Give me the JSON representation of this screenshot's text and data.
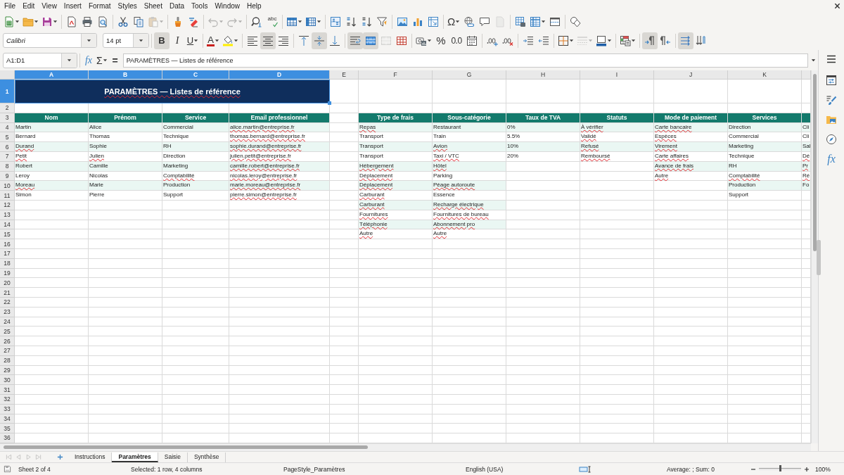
{
  "menu_bar": {
    "items": [
      "File",
      "Edit",
      "View",
      "Insert",
      "Format",
      "Styles",
      "Sheet",
      "Data",
      "Tools",
      "Window",
      "Help"
    ]
  },
  "standard_toolbar": [
    [
      {
        "kind": "new",
        "disabled": false
      },
      {
        "kind": "open",
        "disabled": false
      },
      {
        "kind": "save",
        "disabled": false
      }
    ],
    [
      {
        "kind": "pdf",
        "disabled": false
      },
      {
        "kind": "print",
        "disabled": false
      },
      {
        "kind": "preview",
        "disabled": false
      }
    ],
    [
      {
        "kind": "cut",
        "disabled": false
      },
      {
        "kind": "copy",
        "disabled": false
      },
      {
        "kind": "paste",
        "disabled": true
      }
    ],
    [
      {
        "kind": "clone",
        "disabled": false
      },
      {
        "kind": "clear",
        "disabled": false
      }
    ],
    [
      {
        "kind": "undo",
        "disabled": true
      },
      {
        "kind": "redo",
        "disabled": true
      }
    ],
    [
      {
        "kind": "find",
        "disabled": false
      },
      {
        "kind": "spelling",
        "label": "abc",
        "disabled": false
      }
    ],
    [
      {
        "kind": "row",
        "disabled": false
      },
      {
        "kind": "column",
        "disabled": false
      }
    ],
    [
      {
        "kind": "sort",
        "disabled": false
      },
      {
        "kind": "ascending",
        "disabled": false
      },
      {
        "kind": "descending",
        "disabled": false
      },
      {
        "kind": "filter",
        "disabled": false
      }
    ],
    [
      {
        "kind": "image",
        "disabled": false
      },
      {
        "kind": "chart",
        "disabled": false
      },
      {
        "kind": "pivot",
        "disabled": false
      }
    ],
    [
      {
        "kind": "special",
        "label": "Ω",
        "disabled": false
      },
      {
        "kind": "hyperlink",
        "disabled": false
      },
      {
        "kind": "comment",
        "disabled": false
      },
      {
        "kind": "headers",
        "disabled": true
      }
    ],
    [
      {
        "kind": "printarea",
        "disabled": false
      },
      {
        "kind": "freeze",
        "disabled": false
      },
      {
        "kind": "split",
        "disabled": false
      }
    ],
    [
      {
        "kind": "shapes",
        "disabled": false
      }
    ]
  ],
  "formatting_toolbar": {
    "font_name": "Calibri",
    "font_size": "14 pt",
    "groups": [
      [
        {
          "kind": "bold",
          "label": "B",
          "on": true,
          "disabled": false
        },
        {
          "kind": "italic",
          "label": "I",
          "on": false,
          "disabled": false
        },
        {
          "kind": "underline",
          "label": "U",
          "on": false,
          "disabled": false
        }
      ],
      [
        {
          "kind": "fontcolor",
          "label": "A",
          "on": false,
          "disabled": false
        },
        {
          "kind": "highlight",
          "on": false,
          "disabled": false
        }
      ],
      [
        {
          "kind": "alignleft",
          "on": false,
          "disabled": false
        },
        {
          "kind": "aligncenter",
          "on": true,
          "disabled": false
        },
        {
          "kind": "alignright",
          "on": false,
          "disabled": false
        }
      ],
      [
        {
          "kind": "aligntop",
          "on": false,
          "disabled": false
        },
        {
          "kind": "alignmiddle",
          "on": true,
          "disabled": false
        },
        {
          "kind": "alignbottom",
          "on": false,
          "disabled": false
        }
      ],
      [
        {
          "kind": "wrap",
          "on": true,
          "disabled": false
        },
        {
          "kind": "mergecenter",
          "on": true,
          "disabled": false
        },
        {
          "kind": "merge",
          "on": false,
          "disabled": true
        },
        {
          "kind": "unmerge",
          "on": false,
          "disabled": false
        }
      ],
      [
        {
          "kind": "currency",
          "on": false,
          "disabled": false
        },
        {
          "kind": "percent",
          "label": "%",
          "on": false,
          "disabled": false
        },
        {
          "kind": "number",
          "label": "0.0",
          "on": false,
          "disabled": false
        },
        {
          "kind": "date",
          "on": false,
          "disabled": false
        }
      ],
      [
        {
          "kind": "adddecimal",
          "on": false,
          "disabled": false
        },
        {
          "kind": "deldecimal",
          "on": false,
          "disabled": false
        }
      ],
      [
        {
          "kind": "indent",
          "on": false,
          "disabled": false
        },
        {
          "kind": "outdent",
          "on": false,
          "disabled": false
        }
      ],
      [
        {
          "kind": "borders",
          "on": false,
          "disabled": false
        },
        {
          "kind": "borderstyle",
          "on": false,
          "disabled": true
        },
        {
          "kind": "bordercolor",
          "on": false,
          "disabled": false
        }
      ],
      [
        {
          "kind": "conditional",
          "on": false,
          "disabled": false
        }
      ],
      [
        {
          "kind": "ltr",
          "on": true,
          "disabled": false
        },
        {
          "kind": "rtl",
          "on": false,
          "disabled": false
        }
      ],
      [
        {
          "kind": "horizontal",
          "on": true,
          "disabled": false
        },
        {
          "kind": "vertical",
          "on": false,
          "disabled": false
        }
      ]
    ]
  },
  "formula_bar": {
    "name_box": "A1:D1",
    "buttons": [
      {
        "kind": "wizard",
        "label": "fx"
      },
      {
        "kind": "sum",
        "label": "Σ"
      },
      {
        "kind": "formula",
        "label": "="
      }
    ],
    "content": "PARAMÈTRES — Listes de référence"
  },
  "sidebar": {
    "buttons": [
      {
        "kind": "menu"
      },
      {
        "kind": "properties"
      },
      {
        "kind": "styles"
      },
      {
        "kind": "gallery"
      },
      {
        "kind": "navigator"
      },
      {
        "kind": "functions",
        "label": "fx"
      }
    ]
  },
  "sheet": {
    "columns": [
      {
        "label": "A",
        "selected": true
      },
      {
        "label": "B",
        "selected": true
      },
      {
        "label": "C",
        "selected": true
      },
      {
        "label": "D",
        "selected": true
      },
      {
        "label": "E",
        "selected": false
      },
      {
        "label": "F",
        "selected": false
      },
      {
        "label": "G",
        "selected": false
      },
      {
        "label": "H",
        "selected": false
      },
      {
        "label": "I",
        "selected": false
      },
      {
        "label": "J",
        "selected": false
      },
      {
        "label": "K",
        "selected": false
      }
    ],
    "rows": [
      {
        "label": "1",
        "selected": true
      },
      {
        "label": "2",
        "selected": false
      },
      {
        "label": "3",
        "selected": false
      },
      {
        "label": "4",
        "selected": false
      },
      {
        "label": "5",
        "selected": false
      },
      {
        "label": "6",
        "selected": false
      },
      {
        "label": "7",
        "selected": false
      },
      {
        "label": "8",
        "selected": false
      },
      {
        "label": "9",
        "selected": false
      },
      {
        "label": "10",
        "selected": false
      },
      {
        "label": "11",
        "selected": false
      },
      {
        "label": "12",
        "selected": false
      },
      {
        "label": "13",
        "selected": false
      },
      {
        "label": "14",
        "selected": false
      },
      {
        "label": "15",
        "selected": false
      },
      {
        "label": "16",
        "selected": false
      },
      {
        "label": "17",
        "selected": false
      },
      {
        "label": "18",
        "selected": false
      },
      {
        "label": "19",
        "selected": false
      },
      {
        "label": "20",
        "selected": false
      },
      {
        "label": "21",
        "selected": false
      },
      {
        "label": "22",
        "selected": false
      },
      {
        "label": "23",
        "selected": false
      },
      {
        "label": "24",
        "selected": false
      },
      {
        "label": "25",
        "selected": false
      },
      {
        "label": "26",
        "selected": false
      },
      {
        "label": "27",
        "selected": false
      },
      {
        "label": "28",
        "selected": false
      },
      {
        "label": "29",
        "selected": false
      },
      {
        "label": "30",
        "selected": false
      },
      {
        "label": "31",
        "selected": false
      },
      {
        "label": "32",
        "selected": false
      },
      {
        "label": "33",
        "selected": false
      },
      {
        "label": "34",
        "selected": false
      },
      {
        "label": "35",
        "selected": false
      },
      {
        "label": "36",
        "selected": false
      }
    ],
    "title": {
      "text": "PARAMÈTRES — Listes de référence",
      "spell_error": true
    },
    "tables": [
      {
        "columns": [
          {
            "header": "Nom",
            "cells": [
              {
                "text": "Martin",
                "spell_error": false
              },
              {
                "text": "Bernard",
                "spell_error": false
              },
              {
                "text": "Durand",
                "spell_error": true
              },
              {
                "text": "Petit",
                "spell_error": true
              },
              {
                "text": "Robert",
                "spell_error": false
              },
              {
                "text": "Leroy",
                "spell_error": false
              },
              {
                "text": "Moreau",
                "spell_error": true
              },
              {
                "text": "Simon",
                "spell_error": false
              }
            ]
          },
          {
            "header": "Prénom",
            "cells": [
              {
                "text": "Alice",
                "spell_error": false
              },
              {
                "text": "Thomas",
                "spell_error": false
              },
              {
                "text": "Sophie",
                "spell_error": false
              },
              {
                "text": "Julien",
                "spell_error": true
              },
              {
                "text": "Camille",
                "spell_error": false
              },
              {
                "text": "Nicolas",
                "spell_error": false
              },
              {
                "text": "Marie",
                "spell_error": false
              },
              {
                "text": "Pierre",
                "spell_error": false
              }
            ]
          },
          {
            "header": "Service",
            "cells": [
              {
                "text": "Commercial",
                "spell_error": false
              },
              {
                "text": "Technique",
                "spell_error": false
              },
              {
                "text": "RH",
                "spell_error": false
              },
              {
                "text": "Direction",
                "spell_error": false
              },
              {
                "text": "Marketing",
                "spell_error": false
              },
              {
                "text": "Comptabilité",
                "spell_error": true
              },
              {
                "text": "Production",
                "spell_error": false
              },
              {
                "text": "Support",
                "spell_error": false
              }
            ]
          },
          {
            "header": "Email professionnel",
            "cells": [
              {
                "text": "alice.martin@entreprise.fr",
                "spell_error": true
              },
              {
                "text": "thomas.bernard@entreprise.fr",
                "spell_error": true
              },
              {
                "text": "sophie.durand@entreprise.fr",
                "spell_error": true
              },
              {
                "text": "julien.petit@entreprise.fr",
                "spell_error": true
              },
              {
                "text": "camille.robert@entreprise.fr",
                "spell_error": true
              },
              {
                "text": "nicolas.leroy@entreprise.fr",
                "spell_error": true
              },
              {
                "text": "marie.moreau@entreprise.fr",
                "spell_error": true
              },
              {
                "text": "pierre.simon@entreprise.fr",
                "spell_error": true
              }
            ]
          }
        ]
      },
      {
        "columns": [
          {
            "header": "Type de frais",
            "cells": [
              {
                "text": "Repas",
                "spell_error": true
              },
              {
                "text": "Transport",
                "spell_error": false
              },
              {
                "text": "Transport",
                "spell_error": false
              },
              {
                "text": "Transport",
                "spell_error": false
              },
              {
                "text": "Hébergement",
                "spell_error": true
              },
              {
                "text": "Déplacement",
                "spell_error": true
              },
              {
                "text": "Déplacement",
                "spell_error": true
              },
              {
                "text": "Carburant",
                "spell_error": true
              },
              {
                "text": "Carburant",
                "spell_error": true
              },
              {
                "text": "Fournitures",
                "spell_error": true
              },
              {
                "text": "Téléphonie",
                "spell_error": true
              },
              {
                "text": "Autre",
                "spell_error": true
              }
            ]
          },
          {
            "header": "Sous-catégorie",
            "cells": [
              {
                "text": "Restaurant",
                "spell_error": false
              },
              {
                "text": "Train",
                "spell_error": false
              },
              {
                "text": "Avion",
                "spell_error": true
              },
              {
                "text": "Taxi / VTC",
                "spell_error": true
              },
              {
                "text": "Hôtel",
                "spell_error": true
              },
              {
                "text": "Parking",
                "spell_error": false
              },
              {
                "text": "Péage autoroute",
                "spell_error": true
              },
              {
                "text": "Essence",
                "spell_error": false
              },
              {
                "text": "Recharge électrique",
                "spell_error": true
              },
              {
                "text": "Fournitures de bureau",
                "spell_error": true
              },
              {
                "text": "Abonnement pro",
                "spell_error": true
              },
              {
                "text": "Autre",
                "spell_error": true
              }
            ]
          }
        ]
      },
      {
        "columns": [
          {
            "header": "Taux de TVA",
            "cells": [
              {
                "text": "0%",
                "spell_error": false
              },
              {
                "text": "5.5%",
                "spell_error": false
              },
              {
                "text": "10%",
                "spell_error": false
              },
              {
                "text": "20%",
                "spell_error": false
              }
            ]
          }
        ]
      },
      {
        "columns": [
          {
            "header": "Statuts",
            "cells": [
              {
                "text": "À vérifier",
                "spell_error": true
              },
              {
                "text": "Validé",
                "spell_error": true
              },
              {
                "text": "Refusé",
                "spell_error": true
              },
              {
                "text": "Remboursé",
                "spell_error": true
              }
            ]
          }
        ]
      },
      {
        "columns": [
          {
            "header": "Mode de paiement",
            "cells": [
              {
                "text": "Carte bancaire",
                "spell_error": true
              },
              {
                "text": "Espèces",
                "spell_error": true
              },
              {
                "text": "Virement",
                "spell_error": true
              },
              {
                "text": "Carte affaires",
                "spell_error": true
              },
              {
                "text": "Avance de frais",
                "spell_error": true
              },
              {
                "text": "Autre",
                "spell_error": true
              }
            ]
          }
        ]
      },
      {
        "columns": [
          {
            "header": "Services",
            "cells": [
              {
                "text": "Direction",
                "spell_error": false
              },
              {
                "text": "Commercial",
                "spell_error": false
              },
              {
                "text": "Marketing",
                "spell_error": false
              },
              {
                "text": "Technique",
                "spell_error": false
              },
              {
                "text": "RH",
                "spell_error": false
              },
              {
                "text": "Comptabilité",
                "spell_error": true
              },
              {
                "text": "Production",
                "spell_error": false
              },
              {
                "text": "Support",
                "spell_error": false
              }
            ]
          }
        ]
      },
      {
        "columns": [
          {
            "cells": [
              {
                "text": "Cli",
                "spell_error": false
              },
              {
                "text": "Cli",
                "spell_error": false
              },
              {
                "text": "Sal",
                "spell_error": false
              },
              {
                "text": "Dé",
                "spell_error": true
              },
              {
                "text": "Pr",
                "spell_error": true
              },
              {
                "text": "Ré",
                "spell_error": true
              },
              {
                "text": "Fo",
                "spell_error": false
              }
            ]
          }
        ]
      }
    ]
  },
  "sheet_tabs": {
    "nav_buttons": [
      {
        "disabled": true
      },
      {
        "disabled": true
      },
      {
        "disabled": true
      },
      {
        "disabled": true
      }
    ],
    "tabs": [
      {
        "label": "Instructions",
        "selected": false
      },
      {
        "label": "Paramètres",
        "selected": true
      },
      {
        "label": "Saisie",
        "selected": false
      },
      {
        "label": "Synthèse",
        "selected": false
      }
    ]
  },
  "status_bar": {
    "sheet": "Sheet 2 of 4",
    "selection": "Selected: 1 row, 4 columns",
    "page_style": "PageStyle_Paramètres",
    "language": "English (USA)",
    "summary": "Average: ; Sum: 0",
    "zoom": {
      "level": 0.5,
      "text": "100%"
    }
  }
}
